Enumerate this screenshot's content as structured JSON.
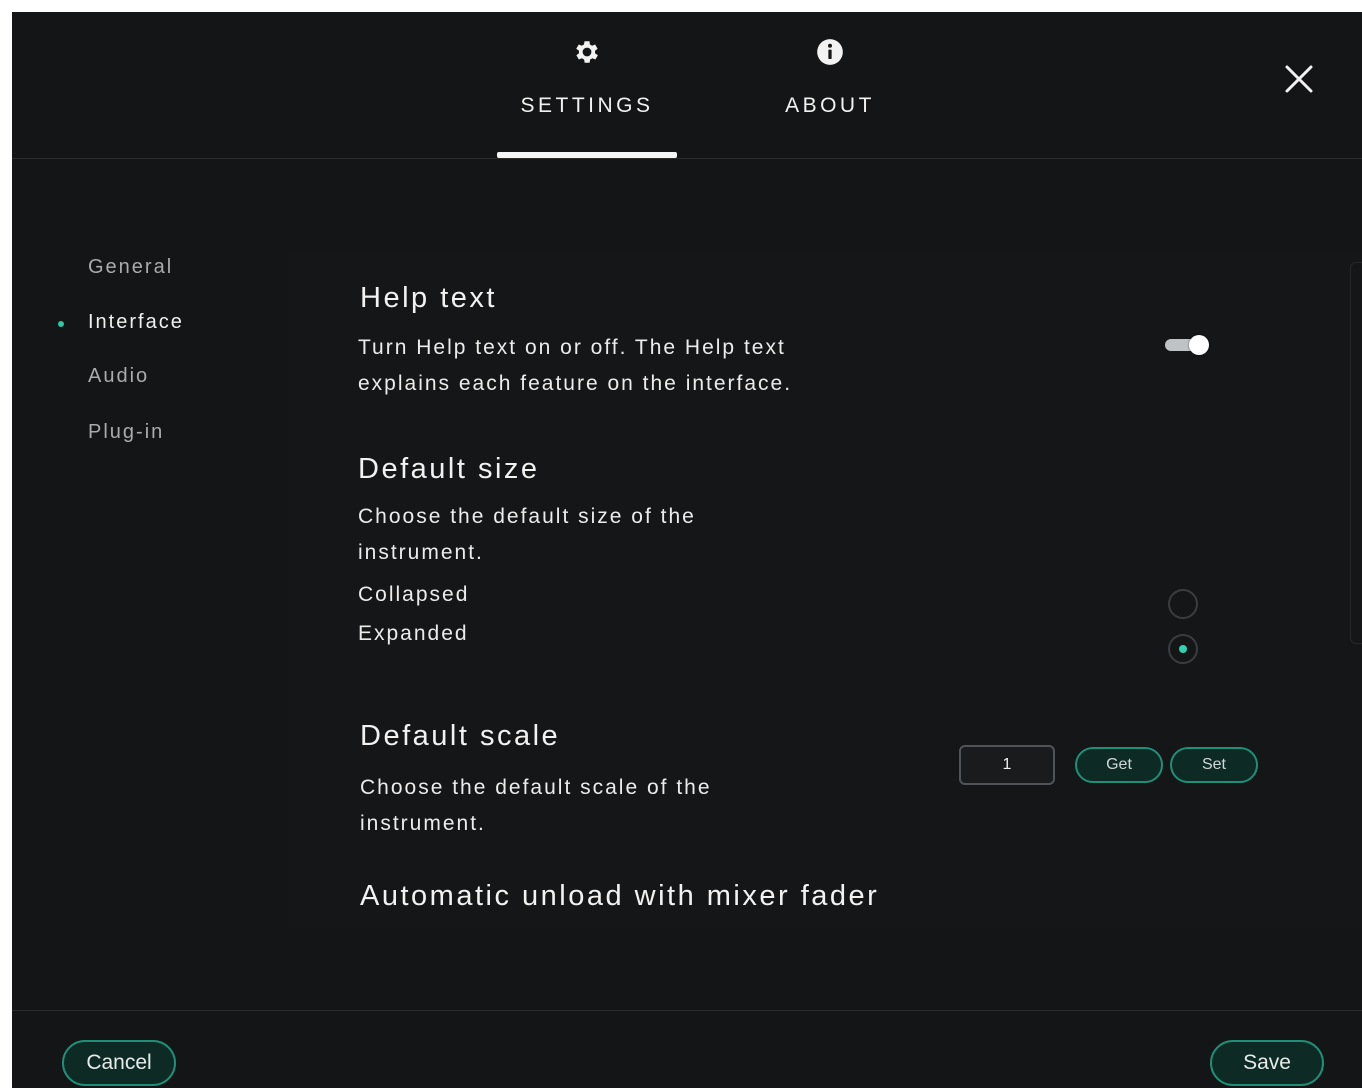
{
  "tabs": [
    {
      "label": "SETTINGS",
      "icon": "gear-icon",
      "active": true
    },
    {
      "label": "ABOUT",
      "icon": "info-icon",
      "active": false
    }
  ],
  "close": {
    "icon": "close-icon"
  },
  "sidebar": {
    "items": [
      {
        "label": "General",
        "active": false
      },
      {
        "label": "Interface",
        "active": true
      },
      {
        "label": "Audio",
        "active": false
      },
      {
        "label": "Plug-in",
        "active": false
      }
    ]
  },
  "sections": {
    "help_text": {
      "title": "Help text",
      "desc_line1": "Turn Help text on or off. The Help text",
      "desc_line2": "explains each feature on the interface.",
      "enabled": true
    },
    "default_size": {
      "title": "Default size",
      "desc_line1": "Choose the default size of the",
      "desc_line2": "instrument.",
      "options": [
        "Collapsed",
        "Expanded"
      ],
      "selected": "Expanded"
    },
    "default_scale": {
      "title": "Default scale",
      "desc_line1": "Choose the default scale of the",
      "desc_line2": "instrument.",
      "value": "1",
      "get_label": "Get",
      "set_label": "Set"
    },
    "auto_unload": {
      "title": "Automatic unload with mixer fader"
    }
  },
  "footer": {
    "cancel_label": "Cancel",
    "save_label": "Save"
  },
  "colors": {
    "background": "#141516",
    "accent": "#2fc7a6",
    "button_border": "#1f8f78"
  }
}
